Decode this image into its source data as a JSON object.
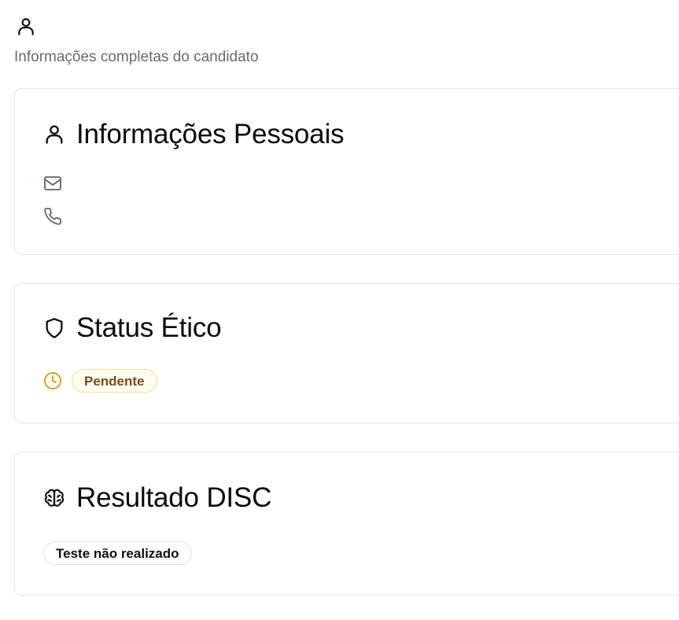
{
  "header": {
    "icon": "user-icon",
    "subtitle": "Informações completas do candidato"
  },
  "personal_info": {
    "title": "Informações Pessoais",
    "title_icon": "user-icon",
    "email_icon": "mail-icon",
    "phone_icon": "phone-icon"
  },
  "ethic_status": {
    "title": "Status Ético",
    "title_icon": "shield-icon",
    "status_icon": "clock-icon",
    "status_label": "Pendente",
    "status_color": "#d9a316"
  },
  "disc_result": {
    "title": "Resultado DISC",
    "title_icon": "brain-icon",
    "status_label": "Teste não realizado"
  }
}
